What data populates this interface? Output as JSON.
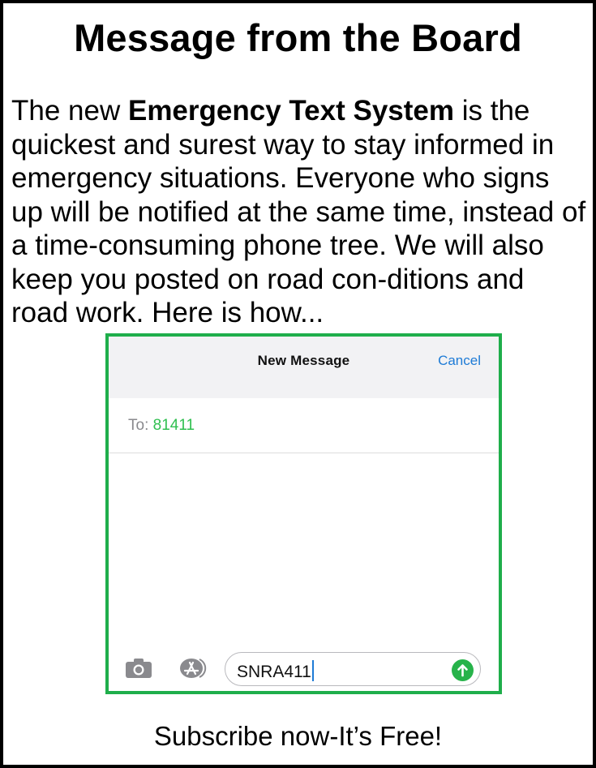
{
  "title": "Message from the Board",
  "body": {
    "intro": "The new ",
    "bold": "Emergency Text System",
    "rest": " is the quickest and surest way to stay informed in emergency situations. Everyone who signs up will be notified at the same time, instead of a time-consuming phone tree. We will also keep you posted on road con-ditions and road work. Here is how..."
  },
  "phone": {
    "nav_title": "New Message",
    "cancel_label": "Cancel",
    "to_label": "To: ",
    "to_value": "81411",
    "message_text": "SNRA411",
    "icons": [
      "camera-icon",
      "app-store-icon",
      "send-arrow-icon"
    ],
    "colors": {
      "frame": "#1fae4b",
      "accent_blue": "#1e7bd6",
      "green": "#2fbf4f"
    }
  },
  "footer": "Subscribe now-It’s Free!"
}
